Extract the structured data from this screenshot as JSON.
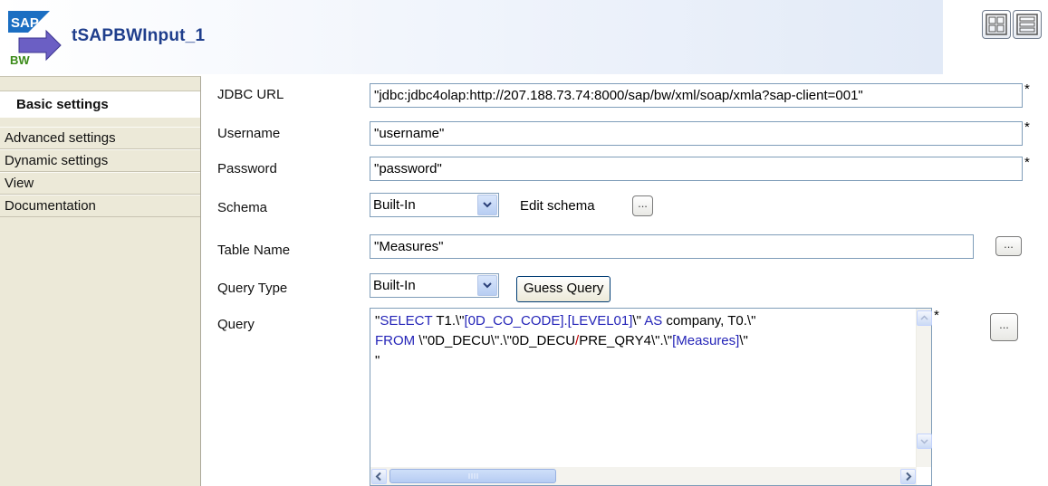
{
  "header": {
    "title": "tSAPBWInput_1",
    "logo": {
      "top_text": "SAP",
      "bottom_text": "BW"
    }
  },
  "tabs": [
    {
      "label": "Basic settings",
      "active": true
    },
    {
      "label": "Advanced settings",
      "active": false
    },
    {
      "label": "Dynamic settings",
      "active": false
    },
    {
      "label": "View",
      "active": false
    },
    {
      "label": "Documentation",
      "active": false
    }
  ],
  "form": {
    "jdbc_url": {
      "label": "JDBC URL",
      "value": "\"jdbc:jdbc4olap:http://207.188.73.74:8000/sap/bw/xml/soap/xmla?sap-client=001\"",
      "required": "*"
    },
    "username": {
      "label": "Username",
      "value": "\"username\"",
      "required": "*"
    },
    "password": {
      "label": "Password",
      "value": "\"password\"",
      "required": "*"
    },
    "schema": {
      "label": "Schema",
      "value": "Built-In",
      "edit_label": "Edit schema",
      "dots": "..."
    },
    "table_name": {
      "label": "Table Name",
      "value": "\"Measures\"",
      "dots": "..."
    },
    "query_type": {
      "label": "Query Type",
      "value": "Built-In",
      "guess_button": "Guess Query"
    },
    "query": {
      "label": "Query",
      "required": "*",
      "dots": "...",
      "line1": {
        "p1": "\"",
        "p2": "SELECT",
        "p3": " T1.\\\"",
        "p4": "[0D_CO_CODE].[LEVEL01]",
        "p5": "\\\" ",
        "p6": "AS",
        "p7": " company, T0.\\\""
      },
      "line2": {
        "p1": "FROM",
        "p2": " \\\"0D_DECU\\\".\\\"0D_DECU",
        "p3": "/",
        "p4": "PRE_QRY4\\\".\\\"",
        "p5": "[Measures]",
        "p6": "\\\""
      },
      "line3": "\""
    }
  },
  "colors": {
    "title": "#1f3e8c",
    "keyword": "#2424b8",
    "operator": "#c00000"
  }
}
